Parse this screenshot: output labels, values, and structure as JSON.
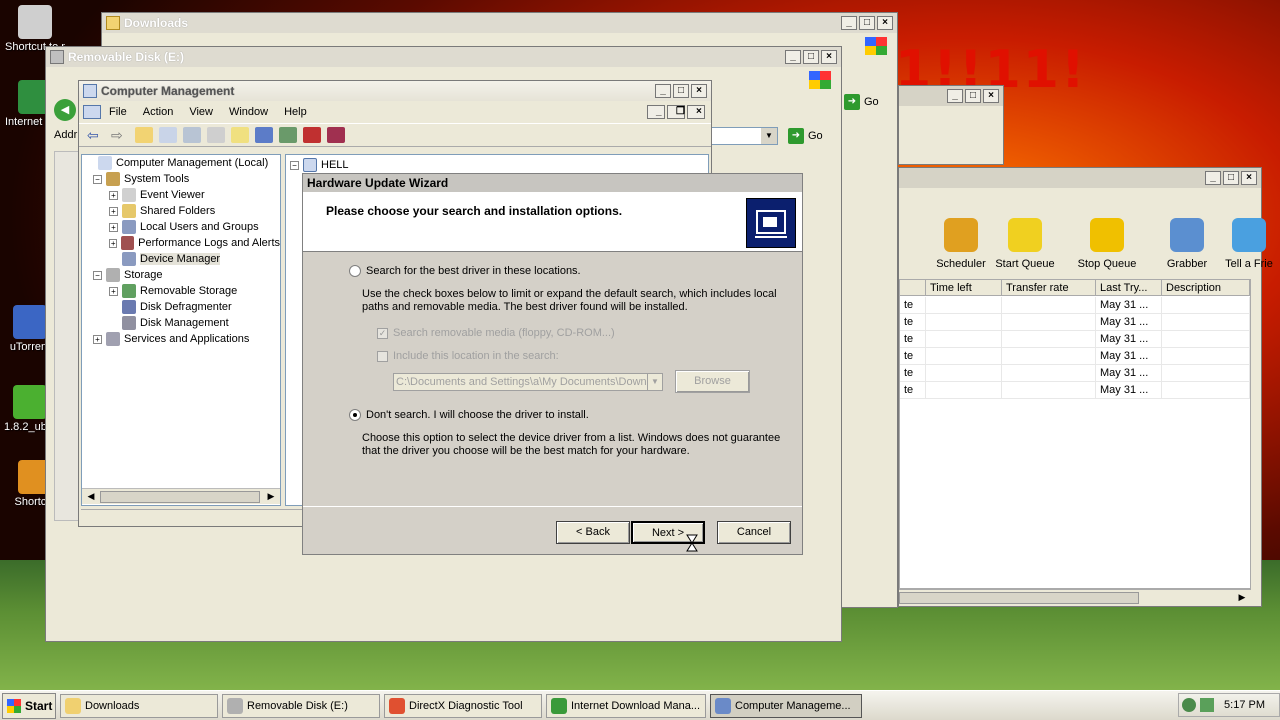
{
  "desktop": {
    "banner_text": "1!!11!",
    "icons": [
      {
        "label": "Shortcut to myp...",
        "color": "#cfcfcf"
      },
      {
        "label": "Internet Downl...",
        "color": "#2f8f3f"
      },
      {
        "label": "uTorrent",
        "color": "#3b66c4"
      },
      {
        "label": "1.8.2_ub...",
        "color": "#4bb030"
      },
      {
        "label": "Shortcut",
        "color": "#e09020"
      }
    ]
  },
  "downloads_window": {
    "title": "Downloads"
  },
  "removable_window": {
    "title": "Removable Disk (E:)",
    "go_label": "Go",
    "address_label": "Addr"
  },
  "idm_window": {
    "toolbar": [
      {
        "label": "Scheduler",
        "color": "#e0a020"
      },
      {
        "label": "Start Queue",
        "color": "#f0d020"
      },
      {
        "label": "Stop Queue",
        "color": "#f0c000"
      },
      {
        "label": "Grabber",
        "color": "#5b8fd0"
      },
      {
        "label": "Tell a Frie",
        "color": "#4aa0e0"
      }
    ],
    "columns": [
      "Time left",
      "Transfer rate",
      "Last Try...",
      "Description"
    ],
    "rows": [
      {
        "status": "te",
        "last_try": "May 31 ..."
      },
      {
        "status": "te",
        "last_try": "May 31 ..."
      },
      {
        "status": "te",
        "last_try": "May 31 ..."
      },
      {
        "status": "te",
        "last_try": "May 31 ..."
      },
      {
        "status": "te",
        "last_try": "May 31 ..."
      },
      {
        "status": "te",
        "last_try": "May 31 ..."
      }
    ],
    "go_label": "Go"
  },
  "computer_management": {
    "title": "Computer Management",
    "menu": [
      "File",
      "Action",
      "View",
      "Window",
      "Help"
    ],
    "tree": {
      "root": "Computer Management (Local)",
      "system_tools": "System Tools",
      "event_viewer": "Event Viewer",
      "shared_folders": "Shared Folders",
      "local_users": "Local Users and Groups",
      "perf_logs": "Performance Logs and Alerts",
      "device_manager": "Device Manager",
      "storage": "Storage",
      "removable_storage": "Removable Storage",
      "disk_defrag": "Disk Defragmenter",
      "disk_management": "Disk Management",
      "services": "Services and Applications"
    },
    "right_root": "HELL"
  },
  "wizard": {
    "title": "Hardware Update Wizard",
    "header": "Please choose your search and installation options.",
    "option_search": "Search for the best driver in these locations.",
    "search_desc": "Use the check boxes below to limit or expand the default search, which includes local paths and removable media. The best driver found will be installed.",
    "check_removable": "Search removable media (floppy, CD-ROM...)",
    "check_include": "Include this location in the search:",
    "location_value": "C:\\Documents and Settings\\a\\My Documents\\Down",
    "browse_label": "Browse",
    "option_dont_search": "Don't search. I will choose the driver to install.",
    "dont_search_desc": "Choose this option to select the device driver from a list.  Windows does not guarantee that the driver you choose will be the best match for your hardware.",
    "back_label": "< Back",
    "next_label": "Next >",
    "cancel_label": "Cancel"
  },
  "taskbar": {
    "start_label": "Start",
    "tasks": [
      {
        "label": "Downloads",
        "color": "#f0d070",
        "active": false
      },
      {
        "label": "Removable Disk (E:)",
        "color": "#b0b0b0",
        "active": false
      },
      {
        "label": "DirectX Diagnostic Tool",
        "color": "#e05030",
        "active": false
      },
      {
        "label": "Internet Download Mana...",
        "color": "#3a9a3a",
        "active": false
      },
      {
        "label": "Computer Manageme...",
        "color": "#6a8ac8",
        "active": true
      }
    ],
    "clock": "5:17 PM"
  }
}
